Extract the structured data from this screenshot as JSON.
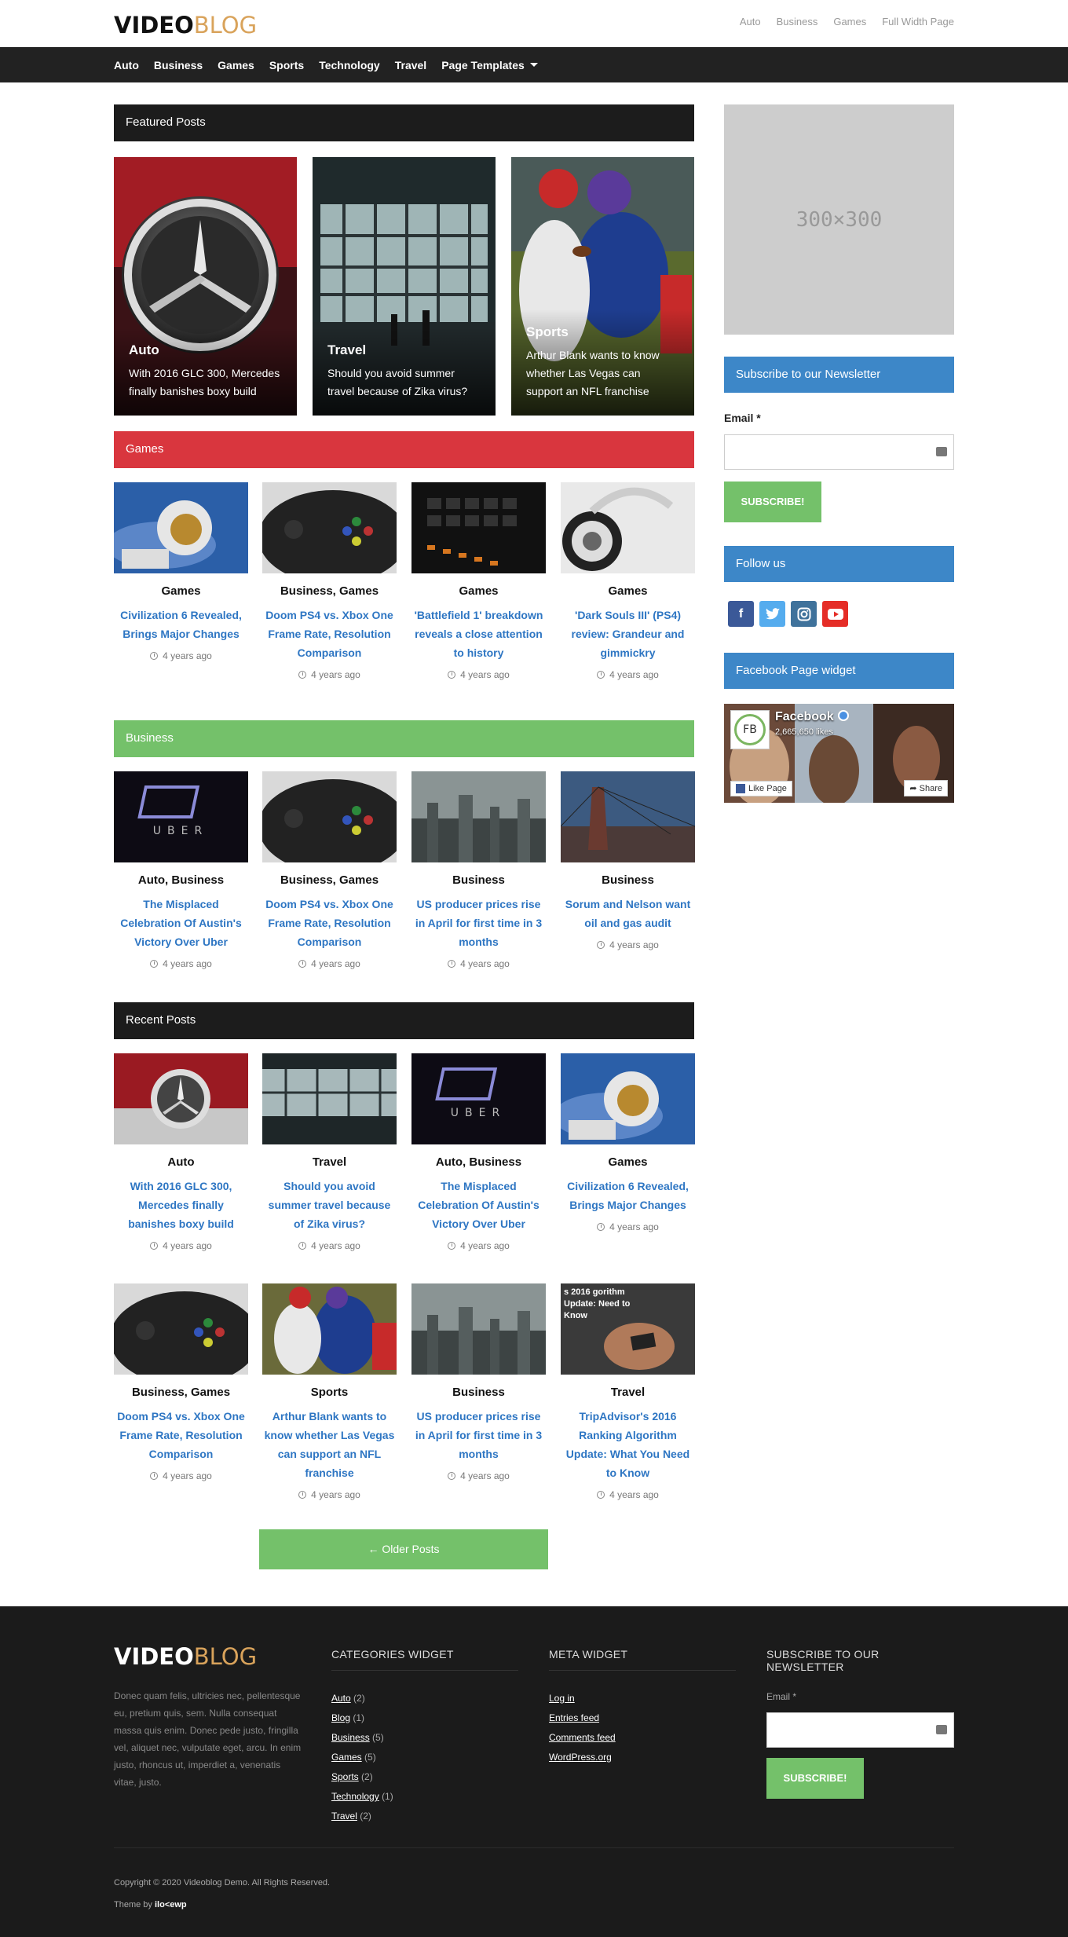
{
  "header": {
    "logo_part1": "VIDEO",
    "logo_part2": "BLOG",
    "top_links": [
      "Auto",
      "Business",
      "Games",
      "Full Width Page"
    ]
  },
  "nav": {
    "items": [
      "Auto",
      "Business",
      "Games",
      "Sports",
      "Technology",
      "Travel",
      "Page Templates"
    ]
  },
  "featured": {
    "title": "Featured Posts",
    "posts": [
      {
        "cat": "Auto",
        "title": "With 2016 GLC 300, Mercedes finally banishes boxy build"
      },
      {
        "cat": "Travel",
        "title": "Should you avoid summer travel because of Zika virus?"
      },
      {
        "cat": "Sports",
        "title": "Arthur Blank wants to know whether Las Vegas can support an NFL franchise"
      }
    ]
  },
  "games": {
    "title": "Games",
    "posts": [
      {
        "cat": "Games",
        "title": "Civilization 6 Revealed, Brings Major Changes",
        "time": "4 years ago"
      },
      {
        "cat": "Business, Games",
        "title": "Doom PS4 vs. Xbox One Frame Rate, Resolution Comparison",
        "time": "4 years ago"
      },
      {
        "cat": "Games",
        "title": "'Battlefield 1' breakdown reveals a close attention to history",
        "time": "4 years ago"
      },
      {
        "cat": "Games",
        "title": "'Dark Souls III' (PS4) review: Grandeur and gimmickry",
        "time": "4 years ago"
      }
    ]
  },
  "business": {
    "title": "Business",
    "posts": [
      {
        "cat": "Auto, Business",
        "title": "The Misplaced Celebration Of Austin's Victory Over Uber",
        "time": "4 years ago"
      },
      {
        "cat": "Business, Games",
        "title": "Doom PS4 vs. Xbox One Frame Rate, Resolution Comparison",
        "time": "4 years ago"
      },
      {
        "cat": "Business",
        "title": "US producer prices rise in April for first time in 3 months",
        "time": "4 years ago"
      },
      {
        "cat": "Business",
        "title": "Sorum and Nelson want oil and gas audit",
        "time": "4 years ago"
      }
    ]
  },
  "recent": {
    "title": "Recent Posts",
    "posts": [
      {
        "cat": "Auto",
        "title": "With 2016 GLC 300, Mercedes finally banishes boxy build",
        "time": "4 years ago"
      },
      {
        "cat": "Travel",
        "title": "Should you avoid summer travel because of Zika virus?",
        "time": "4 years ago"
      },
      {
        "cat": "Auto, Business",
        "title": "The Misplaced Celebration Of Austin's Victory Over Uber",
        "time": "4 years ago"
      },
      {
        "cat": "Games",
        "title": "Civilization 6 Revealed, Brings Major Changes",
        "time": "4 years ago"
      },
      {
        "cat": "Business, Games",
        "title": "Doom PS4 vs. Xbox One Frame Rate, Resolution Comparison",
        "time": "4 years ago"
      },
      {
        "cat": "Sports",
        "title": "Arthur Blank wants to know whether Las Vegas can support an NFL franchise",
        "time": "4 years ago"
      },
      {
        "cat": "Business",
        "title": "US producer prices rise in April for first time in 3 months",
        "time": "4 years ago"
      },
      {
        "cat": "Travel",
        "title": "TripAdvisor's 2016 Ranking Algorithm Update: What You Need to Know",
        "time": "4 years ago"
      }
    ],
    "thumb_overlay_text": "s 2016 gorithm Update: Need to Know"
  },
  "older_posts": "← Older Posts",
  "sidebar": {
    "ad_text": "300×300",
    "newsletter_title": "Subscribe to our Newsletter",
    "email_label": "Email *",
    "subscribe_label": "SUBSCRIBE!",
    "follow_title": "Follow us",
    "facebook_title": "Facebook Page widget",
    "fb_name": "Facebook",
    "fb_likes": "2,665,650 likes",
    "fb_logo": "FB",
    "fb_like_btn": "Like Page",
    "fb_share_btn": "Share"
  },
  "footer": {
    "logo_part1": "VIDEO",
    "logo_part2": "BLOG",
    "desc": "Donec quam felis, ultricies nec, pellentesque eu, pretium quis, sem. Nulla consequat massa quis enim. Donec pede justo, fringilla vel, aliquet nec, vulputate eget, arcu. In enim justo, rhoncus ut, imperdiet a, venenatis vitae, justo.",
    "categories_title": "CATEGORIES WIDGET",
    "categories": [
      {
        "name": "Auto",
        "count": "(2)"
      },
      {
        "name": "Blog",
        "count": "(1)"
      },
      {
        "name": "Business",
        "count": "(5)"
      },
      {
        "name": "Games",
        "count": "(5)"
      },
      {
        "name": "Sports",
        "count": "(2)"
      },
      {
        "name": "Technology",
        "count": "(1)"
      },
      {
        "name": "Travel",
        "count": "(2)"
      }
    ],
    "meta_title": "META WIDGET",
    "meta_links": [
      "Log in",
      "Entries feed",
      "Comments feed",
      "WordPress.org"
    ],
    "newsletter_title": "SUBSCRIBE TO OUR NEWSLETTER",
    "email_label": "Email *",
    "subscribe_label": "SUBSCRIBE!",
    "copyright": "Copyright © 2020 Videoblog Demo. All Rights Reserved.",
    "theme_by": "Theme by",
    "theme_brand": "ilo<ewp"
  },
  "colors": {
    "games_bar": "#d9363e",
    "business_bar": "#74c16a",
    "dark_bar": "#1c1c1c",
    "widget_blue": "#3d87c8",
    "link_blue": "#2e76c3"
  }
}
